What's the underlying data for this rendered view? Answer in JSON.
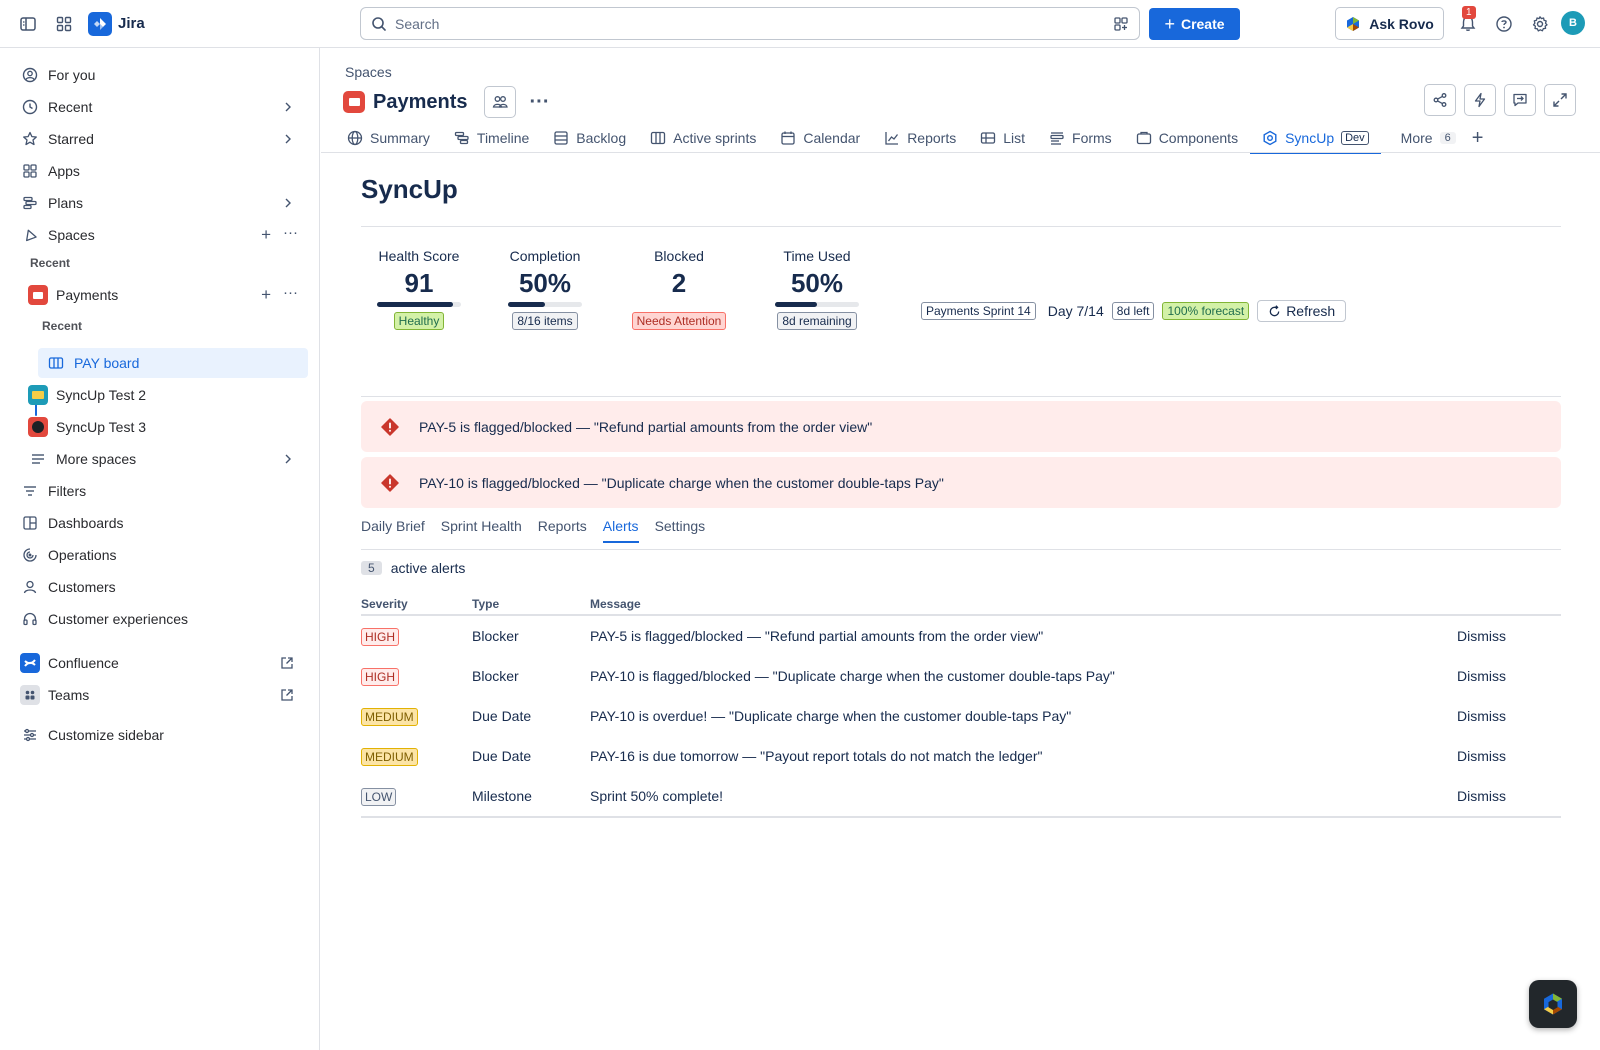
{
  "topbar": {
    "app_name": "Jira",
    "search_placeholder": "Search",
    "create_label": "Create",
    "ask_rovo_label": "Ask Rovo",
    "notification_count": "1",
    "avatar_initial": "B"
  },
  "sidebar": {
    "items": [
      {
        "label": "For you"
      },
      {
        "label": "Recent"
      },
      {
        "label": "Starred"
      },
      {
        "label": "Apps"
      },
      {
        "label": "Plans"
      },
      {
        "label": "Spaces"
      }
    ],
    "recent_header": "Recent",
    "payments_label": "Payments",
    "payments_recent_header": "Recent",
    "pay_board_label": "PAY board",
    "syncup_test2_label": "SyncUp Test 2",
    "syncup_test3_label": "SyncUp Test 3",
    "more_spaces_label": "More spaces",
    "lower_items": [
      {
        "label": "Filters"
      },
      {
        "label": "Dashboards"
      },
      {
        "label": "Operations"
      },
      {
        "label": "Customers"
      },
      {
        "label": "Customer experiences"
      }
    ],
    "confluence_label": "Confluence",
    "teams_label": "Teams",
    "customize_label": "Customize sidebar"
  },
  "header": {
    "breadcrumb": "Spaces",
    "project_title": "Payments"
  },
  "tabs": [
    {
      "label": "Summary",
      "icon": "globe-icon"
    },
    {
      "label": "Timeline",
      "icon": "timeline-icon"
    },
    {
      "label": "Backlog",
      "icon": "backlog-icon"
    },
    {
      "label": "Active sprints",
      "icon": "board-icon"
    },
    {
      "label": "Calendar",
      "icon": "calendar-icon"
    },
    {
      "label": "Reports",
      "icon": "chart-icon"
    },
    {
      "label": "List",
      "icon": "list-icon"
    },
    {
      "label": "Forms",
      "icon": "forms-icon"
    },
    {
      "label": "Components",
      "icon": "components-icon"
    },
    {
      "label": "SyncUp",
      "icon": "syncup-icon",
      "badge": "Dev",
      "active": true
    },
    {
      "label": "More",
      "badge": "6"
    }
  ],
  "syncup": {
    "title": "SyncUp",
    "metrics": [
      {
        "label": "Health Score",
        "value": "91",
        "progress": 0.91,
        "badge": "Healthy",
        "badge_style": "green"
      },
      {
        "label": "Completion",
        "value": "50%",
        "progress": 0.5,
        "badge": "8/16 items",
        "badge_style": "gray"
      },
      {
        "label": "Blocked",
        "value": "2",
        "badge": "Needs Attention",
        "badge_style": "red"
      },
      {
        "label": "Time Used",
        "value": "50%",
        "progress": 0.5,
        "badge": "8d remaining",
        "badge_style": "gray"
      }
    ],
    "sprint": {
      "name": "Payments Sprint 14",
      "day": "Day 7/14",
      "left": "8d left",
      "forecast": "100% forecast",
      "refresh_label": "Refresh"
    },
    "banners": [
      "PAY-5 is flagged/blocked — \"Refund partial amounts from the order view\"",
      "PAY-10 is flagged/blocked — \"Duplicate charge when the customer double-taps Pay\""
    ],
    "subtabs": [
      "Daily Brief",
      "Sprint Health",
      "Reports",
      "Alerts",
      "Settings"
    ],
    "active_subtab": "Alerts",
    "alert_count": "5",
    "alert_count_label": "active alerts",
    "table": {
      "headers": [
        "Severity",
        "Type",
        "Message"
      ],
      "rows": [
        {
          "severity": "HIGH",
          "type": "Blocker",
          "message": "PAY-5 is flagged/blocked — \"Refund partial amounts from the order view\"",
          "action": "Dismiss"
        },
        {
          "severity": "HIGH",
          "type": "Blocker",
          "message": "PAY-10 is flagged/blocked — \"Duplicate charge when the customer double-taps Pay\"",
          "action": "Dismiss"
        },
        {
          "severity": "MEDIUM",
          "type": "Due Date",
          "message": "PAY-10 is overdue! — \"Duplicate charge when the customer double-taps Pay\"",
          "action": "Dismiss"
        },
        {
          "severity": "MEDIUM",
          "type": "Due Date",
          "message": "PAY-16 is due tomorrow — \"Payout report totals do not match the ledger\"",
          "action": "Dismiss"
        },
        {
          "severity": "LOW",
          "type": "Milestone",
          "message": "Sprint 50% complete!",
          "action": "Dismiss"
        }
      ]
    }
  },
  "colors": {
    "accent": "#1868db",
    "high": "#ae2e24",
    "medium": "#7f5f01",
    "healthy": "#216e4e",
    "alert_bg": "#ffeceb"
  }
}
